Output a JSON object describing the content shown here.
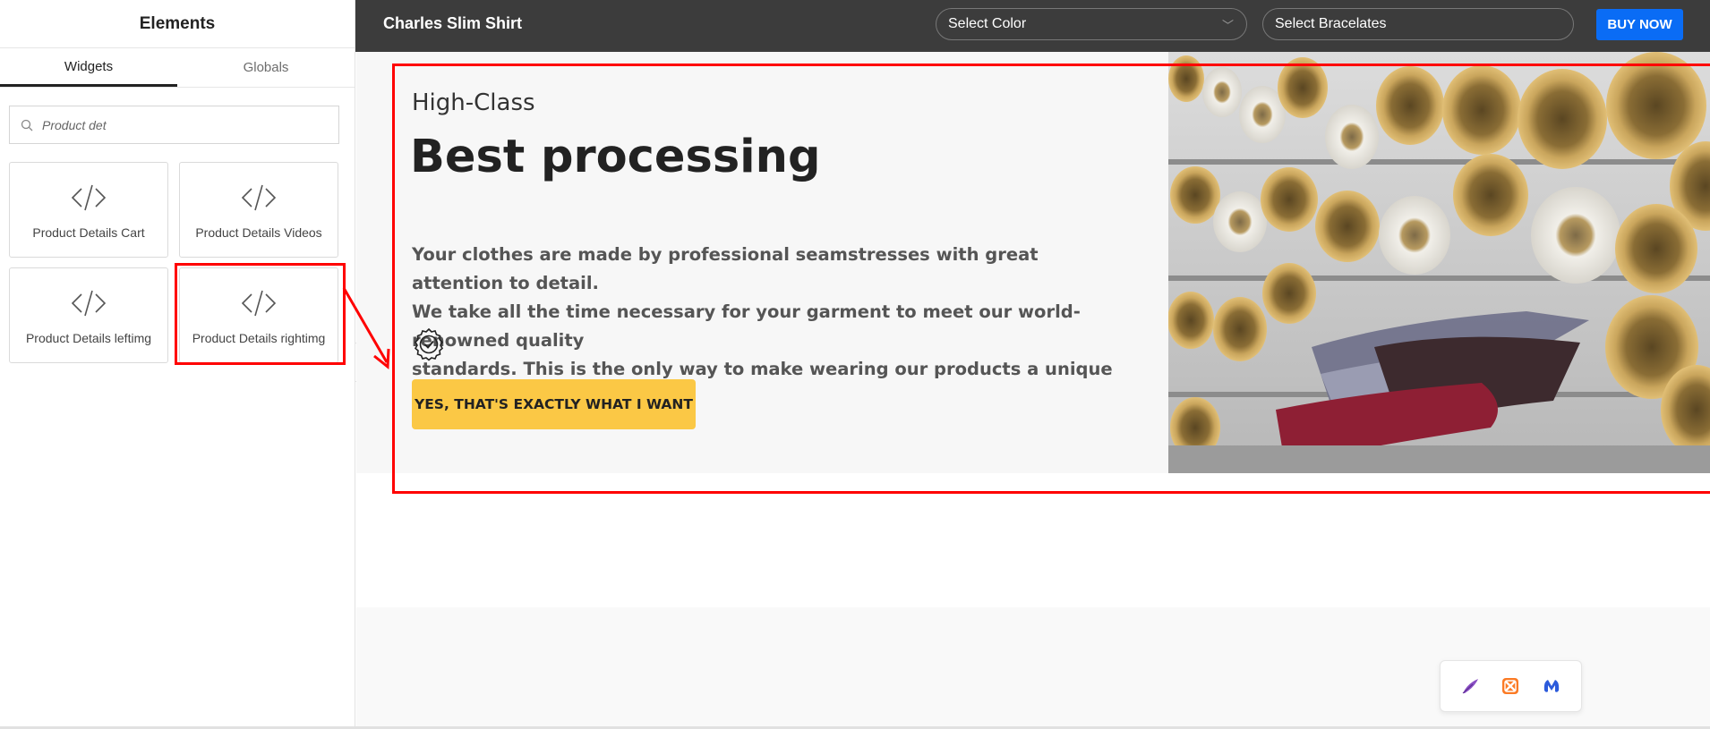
{
  "panel": {
    "title": "Elements",
    "tabs": [
      {
        "label": "Widgets",
        "active": true
      },
      {
        "label": "Globals",
        "active": false
      }
    ],
    "search": {
      "value": "",
      "placeholder": "Product det"
    },
    "widgets": [
      {
        "label": "Product Details Cart",
        "icon": "code-icon"
      },
      {
        "label": "Product Details Videos",
        "icon": "code-icon"
      },
      {
        "label": "Product Details leftimg",
        "icon": "code-icon"
      },
      {
        "label": "Product Details rightimg",
        "icon": "code-icon"
      }
    ]
  },
  "topbar": {
    "product_title": "Charles Slim Shirt",
    "select_color": "Select Color",
    "select_bracelates": "Select Bracelates",
    "buy_button": "BUY NOW"
  },
  "hero": {
    "eyebrow": "High-Class",
    "headline": "Best processing",
    "body_lines": [
      "Your clothes are made by professional seamstresses with great attention to detail.",
      "We take all the time necessary for your garment to meet our world-renowned quality",
      "standards. This is the only way to make wearing our products a unique experience."
    ],
    "badge_icon": "check-badge-icon",
    "cta": "YES, THAT'S EXACTLY WHAT I WANT",
    "image_icon": "fabric-rolls-photo"
  },
  "tray": {
    "icons": [
      "feather-icon",
      "xampp-icon",
      "malwarebytes-icon"
    ]
  },
  "colors": {
    "topbar_bg": "#3c3c3c",
    "buy_button": "#0a6cf5",
    "cta_button": "#fbc845",
    "highlight": "#ff0000"
  }
}
